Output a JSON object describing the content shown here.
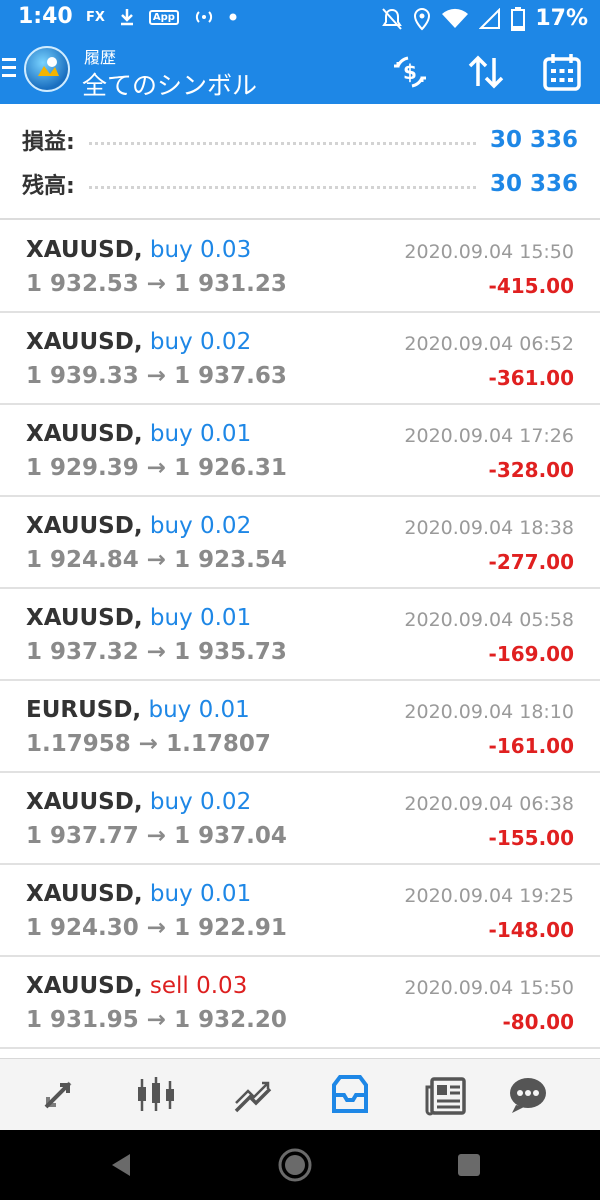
{
  "status_bar": {
    "time": "1:40",
    "fx_label": "FX",
    "app_label": "App",
    "battery": "17%"
  },
  "app_bar": {
    "subtitle": "履歴",
    "title": "全てのシンボル"
  },
  "summary": {
    "profit_label": "損益:",
    "profit_value": "30 336",
    "balance_label": "残高:",
    "balance_value": "30 336"
  },
  "trades": [
    {
      "symbol": "XAUUSD,",
      "side": "buy 0.03",
      "open": "1 932.53",
      "close": "1 931.23",
      "time": "2020.09.04 15:50",
      "profit": "-415.00"
    },
    {
      "symbol": "XAUUSD,",
      "side": "buy 0.02",
      "open": "1 939.33",
      "close": "1 937.63",
      "time": "2020.09.04 06:52",
      "profit": "-361.00"
    },
    {
      "symbol": "XAUUSD,",
      "side": "buy 0.01",
      "open": "1 929.39",
      "close": "1 926.31",
      "time": "2020.09.04 17:26",
      "profit": "-328.00"
    },
    {
      "symbol": "XAUUSD,",
      "side": "buy 0.02",
      "open": "1 924.84",
      "close": "1 923.54",
      "time": "2020.09.04 18:38",
      "profit": "-277.00"
    },
    {
      "symbol": "XAUUSD,",
      "side": "buy 0.01",
      "open": "1 937.32",
      "close": "1 935.73",
      "time": "2020.09.04 05:58",
      "profit": "-169.00"
    },
    {
      "symbol": "EURUSD,",
      "side": "buy 0.01",
      "open": "1.17958",
      "close": "1.17807",
      "time": "2020.09.04 18:10",
      "profit": "-161.00"
    },
    {
      "symbol": "XAUUSD,",
      "side": "buy 0.02",
      "open": "1 937.77",
      "close": "1 937.04",
      "time": "2020.09.04 06:38",
      "profit": "-155.00"
    },
    {
      "symbol": "XAUUSD,",
      "side": "buy 0.01",
      "open": "1 924.30",
      "close": "1 922.91",
      "time": "2020.09.04 19:25",
      "profit": "-148.00"
    },
    {
      "symbol": "XAUUSD,",
      "side": "sell 0.03",
      "open": "1 931.95",
      "close": "1 932.20",
      "time": "2020.09.04 15:50",
      "profit": "-80.00"
    }
  ],
  "arrow": "→",
  "colors": {
    "accent": "#1e87e6",
    "buy": "#1e87e6",
    "sell": "#dd1f1f",
    "loss": "#e02020",
    "tab_inactive": "#555555"
  },
  "icons": {
    "app_bar": [
      "deposit-icon",
      "sort-icon",
      "calendar-icon"
    ],
    "tabs": [
      "quotes-icon",
      "chart-candles-icon",
      "trade-icon",
      "history-icon",
      "news-icon",
      "chat-icon"
    ],
    "nav": [
      "back-icon",
      "home-icon",
      "recents-icon"
    ]
  }
}
